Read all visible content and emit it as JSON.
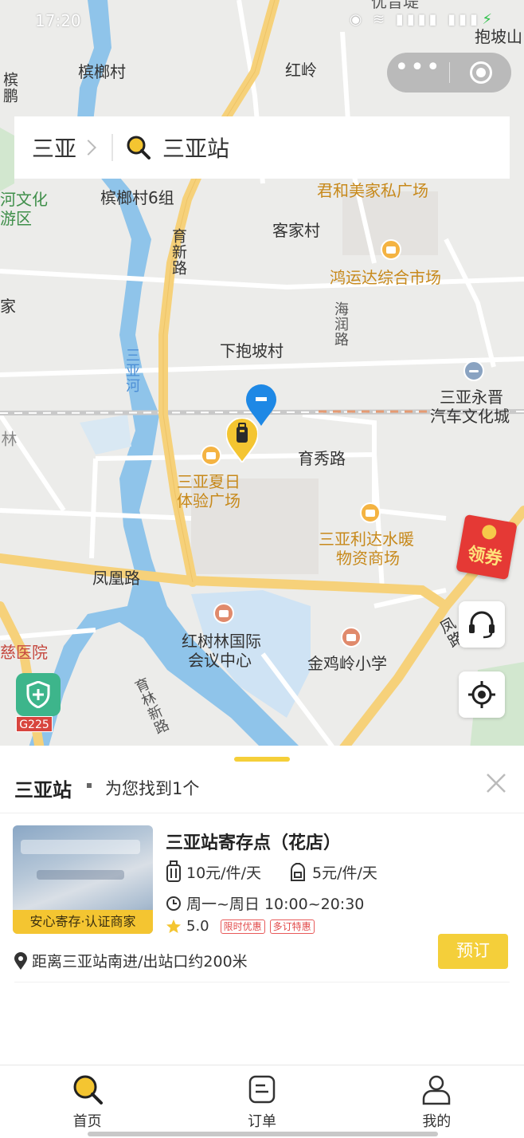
{
  "status_bar": {
    "time": "17:20",
    "battery": "97%"
  },
  "map": {
    "labels": {
      "binlang_village": "槟榔村",
      "hongling": "红岭",
      "baopo_mountain": "抱坡山",
      "top_label": "优音堤",
      "binpeng": "槟鹏",
      "river_culture": "河文化",
      "zone": "游区",
      "binlang_village_6": "槟榔村6组",
      "junhe_plaza": "君和美家私广场",
      "hakka_village": "客家村",
      "yuxin_road": "育新路",
      "hongyunda_market": "鸿运达综合市场",
      "jia": "家",
      "hairun_road": "海润路",
      "xia_baopo_village": "下抱坡村",
      "sanya_river": "三亚河",
      "yongjin_city_1": "三亚永晋",
      "yongjin_city_2": "汽车文化城",
      "lin": "林",
      "yuxiu_road": "育秀路",
      "summer_plaza_1": "三亚夏日",
      "summer_plaza_2": "体验广场",
      "lida_mall_1": "三亚利达水暖",
      "lida_mall_2": "物资商场",
      "fenghuang_road": "凤凰路",
      "feng_road_v": "凤路",
      "hongshulin_center_1": "红树林国际",
      "hongshulin_center_2": "会议中心",
      "ci_hospital": "慈医院",
      "jinjiling_school": "金鸡岭小学",
      "yulin_road": "育林新路",
      "g225": "G225"
    },
    "coupon_label": "领券"
  },
  "capsule": {
    "more": "•••"
  },
  "search": {
    "city": "三亚",
    "query": "三亚站"
  },
  "results": {
    "station": "三亚站",
    "count_text": "为您找到1个"
  },
  "store": {
    "name": "三亚站寄存点（花店）",
    "badge": "安心寄存·认证商家",
    "price_large": "10元/件/天",
    "price_small": "5元/件/天",
    "hours": "周一~周日 10:00~20:30",
    "rating": "5.0",
    "tags": [
      "限时优惠",
      "多订特惠"
    ],
    "distance": "距离三亚站南进/出站口约200米",
    "book_label": "预订"
  },
  "tabs": [
    {
      "label": "首页",
      "icon": "search-icon"
    },
    {
      "label": "订单",
      "icon": "order-icon"
    },
    {
      "label": "我的",
      "icon": "profile-icon"
    }
  ],
  "colors": {
    "accent": "#f4cf3a",
    "map_bg": "#ececea",
    "river": "#8fc4ea",
    "road": "#f6d17a"
  }
}
